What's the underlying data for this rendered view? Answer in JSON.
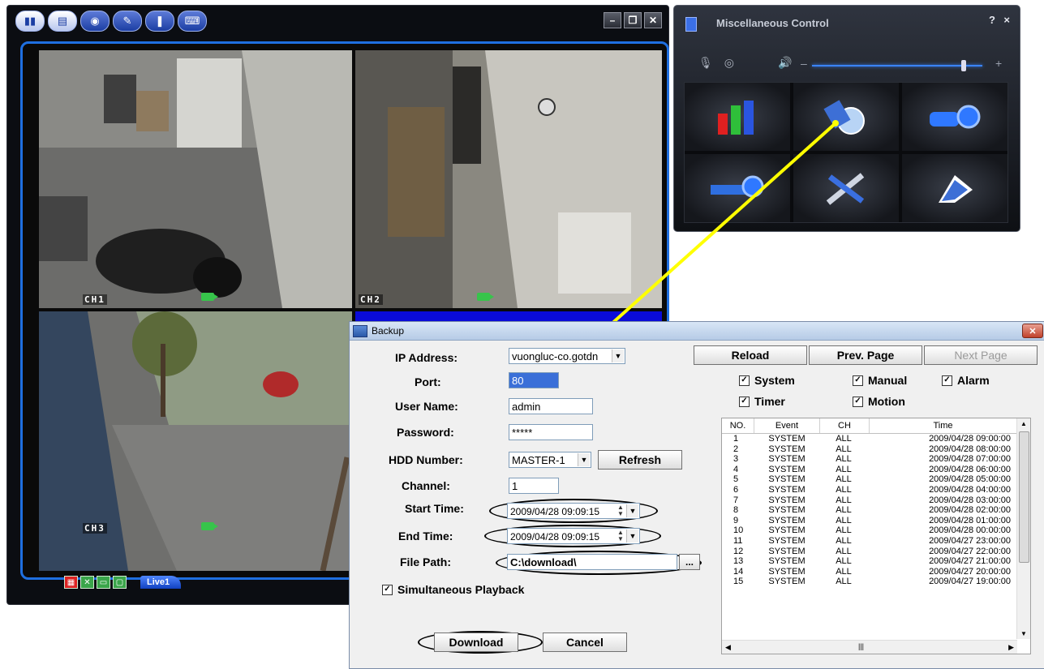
{
  "viewer": {
    "toolbar_icons": [
      "info-icon",
      "files-icon",
      "network-icon",
      "tools-icon",
      "alarm-icon",
      "keyboard-icon"
    ],
    "window_controls": [
      "–",
      "❐",
      "✕"
    ],
    "channels": [
      {
        "label": "CH1"
      },
      {
        "label": "CH2"
      },
      {
        "label": "CH3"
      }
    ],
    "bottom_tab": "Live1"
  },
  "misc": {
    "title": "Miscellaneous Control",
    "help": "?",
    "close": "×",
    "volume_minus": "–",
    "volume_plus": "+",
    "volume_level": 0.9,
    "grid_icons": [
      "bar-chart-icon",
      "backup-icon",
      "camera-settings-icon",
      "network-settings-icon",
      "tools-icon",
      "notepad-icon"
    ]
  },
  "backup": {
    "title": "Backup",
    "close": "✕",
    "labels": {
      "ip": "IP Address:",
      "port": "Port:",
      "user": "User Name:",
      "password": "Password:",
      "hdd": "HDD Number:",
      "channel": "Channel:",
      "start": "Start Time:",
      "end": "End Time:",
      "path": "File Path:"
    },
    "values": {
      "ip": "vuongluc-co.gotdn",
      "port": "80",
      "user": "admin",
      "password": "*****",
      "hdd": "MASTER-1",
      "channel": "1",
      "start": "2009/04/28 09:09:15",
      "end": "2009/04/28 09:09:15",
      "path": "C:\\download\\"
    },
    "browse": "...",
    "refresh": "Refresh",
    "simultaneous": "Simultaneous Playback",
    "download": "Download",
    "cancel": "Cancel",
    "reload": "Reload",
    "prev_page": "Prev. Page",
    "next_page": "Next Page",
    "filters": {
      "system": "System",
      "manual": "Manual",
      "alarm": "Alarm",
      "timer": "Timer",
      "motion": "Motion"
    },
    "table": {
      "headers": [
        "NO.",
        "Event",
        "CH",
        "Time"
      ],
      "rows": [
        [
          "1",
          "SYSTEM",
          "ALL",
          "2009/04/28 09:00:00"
        ],
        [
          "2",
          "SYSTEM",
          "ALL",
          "2009/04/28 08:00:00"
        ],
        [
          "3",
          "SYSTEM",
          "ALL",
          "2009/04/28 07:00:00"
        ],
        [
          "4",
          "SYSTEM",
          "ALL",
          "2009/04/28 06:00:00"
        ],
        [
          "5",
          "SYSTEM",
          "ALL",
          "2009/04/28 05:00:00"
        ],
        [
          "6",
          "SYSTEM",
          "ALL",
          "2009/04/28 04:00:00"
        ],
        [
          "7",
          "SYSTEM",
          "ALL",
          "2009/04/28 03:00:00"
        ],
        [
          "8",
          "SYSTEM",
          "ALL",
          "2009/04/28 02:00:00"
        ],
        [
          "9",
          "SYSTEM",
          "ALL",
          "2009/04/28 01:00:00"
        ],
        [
          "10",
          "SYSTEM",
          "ALL",
          "2009/04/28 00:00:00"
        ],
        [
          "11",
          "SYSTEM",
          "ALL",
          "2009/04/27 23:00:00"
        ],
        [
          "12",
          "SYSTEM",
          "ALL",
          "2009/04/27 22:00:00"
        ],
        [
          "13",
          "SYSTEM",
          "ALL",
          "2009/04/27 21:00:00"
        ],
        [
          "14",
          "SYSTEM",
          "ALL",
          "2009/04/27 20:00:00"
        ],
        [
          "15",
          "SYSTEM",
          "ALL",
          "2009/04/27 19:00:00"
        ]
      ]
    }
  },
  "colors": {
    "accent": "#1f6fe0",
    "highlight_arrow": "#ffff00"
  }
}
